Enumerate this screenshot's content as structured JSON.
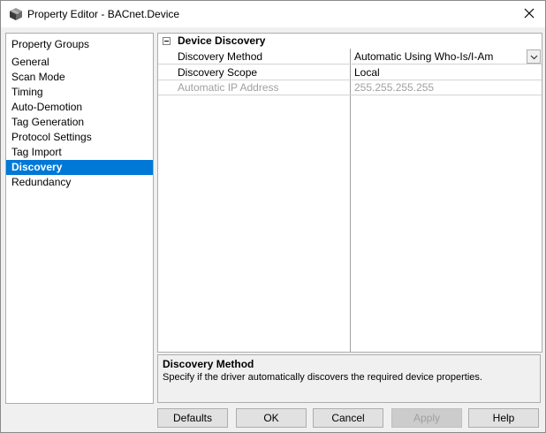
{
  "window": {
    "title": "Property Editor - BACnet.Device",
    "icons": {
      "app": "cube-app-icon",
      "close": "close-icon"
    }
  },
  "groups": {
    "header": "Property Groups",
    "items": [
      {
        "label": "General"
      },
      {
        "label": "Scan Mode"
      },
      {
        "label": "Timing"
      },
      {
        "label": "Auto-Demotion"
      },
      {
        "label": "Tag Generation"
      },
      {
        "label": "Protocol Settings"
      },
      {
        "label": "Tag Import"
      },
      {
        "label": "Discovery",
        "selected": true
      },
      {
        "label": "Redundancy"
      }
    ],
    "selected_color": "#0078d7"
  },
  "grid": {
    "category": "Device Discovery",
    "properties": [
      {
        "name": "Discovery Method",
        "value": "Automatic Using Who-Is/I-Am",
        "dropdown": true
      },
      {
        "name": "Discovery Scope",
        "value": "Local"
      },
      {
        "name": "Automatic IP Address",
        "value": "255.255.255.255",
        "disabled": true
      }
    ]
  },
  "description": {
    "title": "Discovery Method",
    "text": "Specify if the driver automatically discovers the required device properties."
  },
  "buttons": {
    "defaults": "Defaults",
    "ok": "OK",
    "cancel": "Cancel",
    "apply": "Apply",
    "help": "Help"
  }
}
